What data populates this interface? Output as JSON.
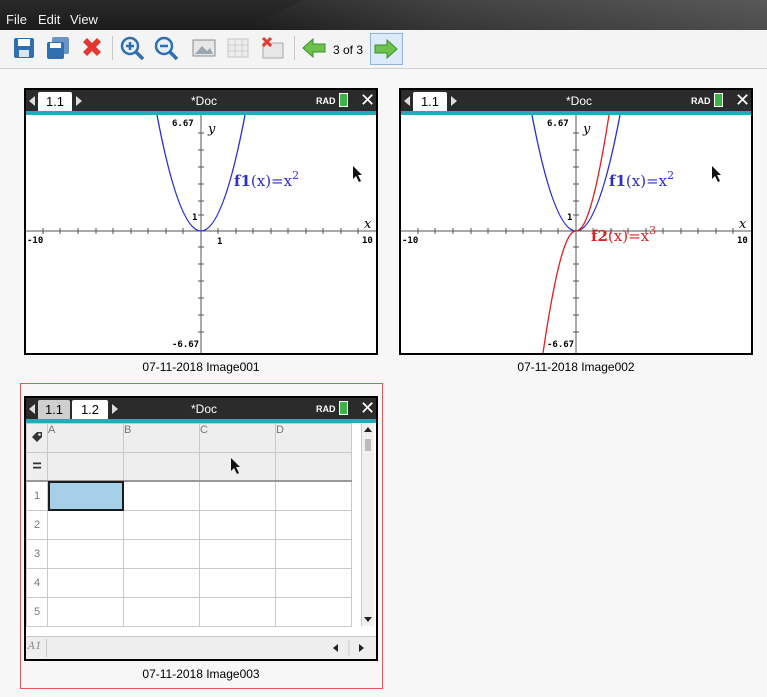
{
  "menu": {
    "file": "File",
    "edit": "Edit",
    "view": "View"
  },
  "toolbar": {
    "icons": [
      "save-icon",
      "save-as-icon",
      "delete-icon",
      "zoom-in-icon",
      "zoom-out-icon",
      "slide-icon",
      "grid-icon",
      "hide-icon",
      "previous-arrow-icon",
      "next-arrow-icon"
    ],
    "page_counter": "3 of 3"
  },
  "thumbnails": [
    {
      "caption": "07-11-2018 Image001",
      "tabs": [
        "1.1"
      ],
      "doc_title": "*Doc",
      "mode": "RAD",
      "graph": {
        "ymax_label": "6.67",
        "ymin_label": "-6.67",
        "xmin_label": "-10",
        "xmax_label": "10",
        "x_label": "x",
        "y_label": "y",
        "tick_x": "1",
        "tick_y": "1",
        "functions": [
          {
            "fname": "f1",
            "arg": "(x)=x",
            "exp": "2",
            "color": "#2b2bd6"
          }
        ]
      }
    },
    {
      "caption": "07-11-2018 Image002",
      "tabs": [
        "1.1"
      ],
      "doc_title": "*Doc",
      "mode": "RAD",
      "graph": {
        "ymax_label": "6.67",
        "ymin_label": "-6.67",
        "xmin_label": "-10",
        "xmax_label": "10",
        "x_label": "x",
        "y_label": "y",
        "tick_y": "1",
        "functions": [
          {
            "fname": "f1",
            "arg": "(x)=x",
            "exp": "2",
            "color": "#2b2bd6"
          },
          {
            "fname": "f2",
            "arg": "(x)=x",
            "exp": "3",
            "color": "#e02020"
          }
        ]
      }
    },
    {
      "caption": "07-11-2018 Image003",
      "tabs": [
        "1.1",
        "1.2"
      ],
      "doc_title": "*Doc",
      "mode": "RAD",
      "sheet": {
        "columns": [
          "A",
          "B",
          "C",
          "D"
        ],
        "rows": [
          "1",
          "2",
          "3",
          "4",
          "5"
        ],
        "formula_symbol": "=",
        "cell_ref": "A1"
      }
    }
  ]
}
